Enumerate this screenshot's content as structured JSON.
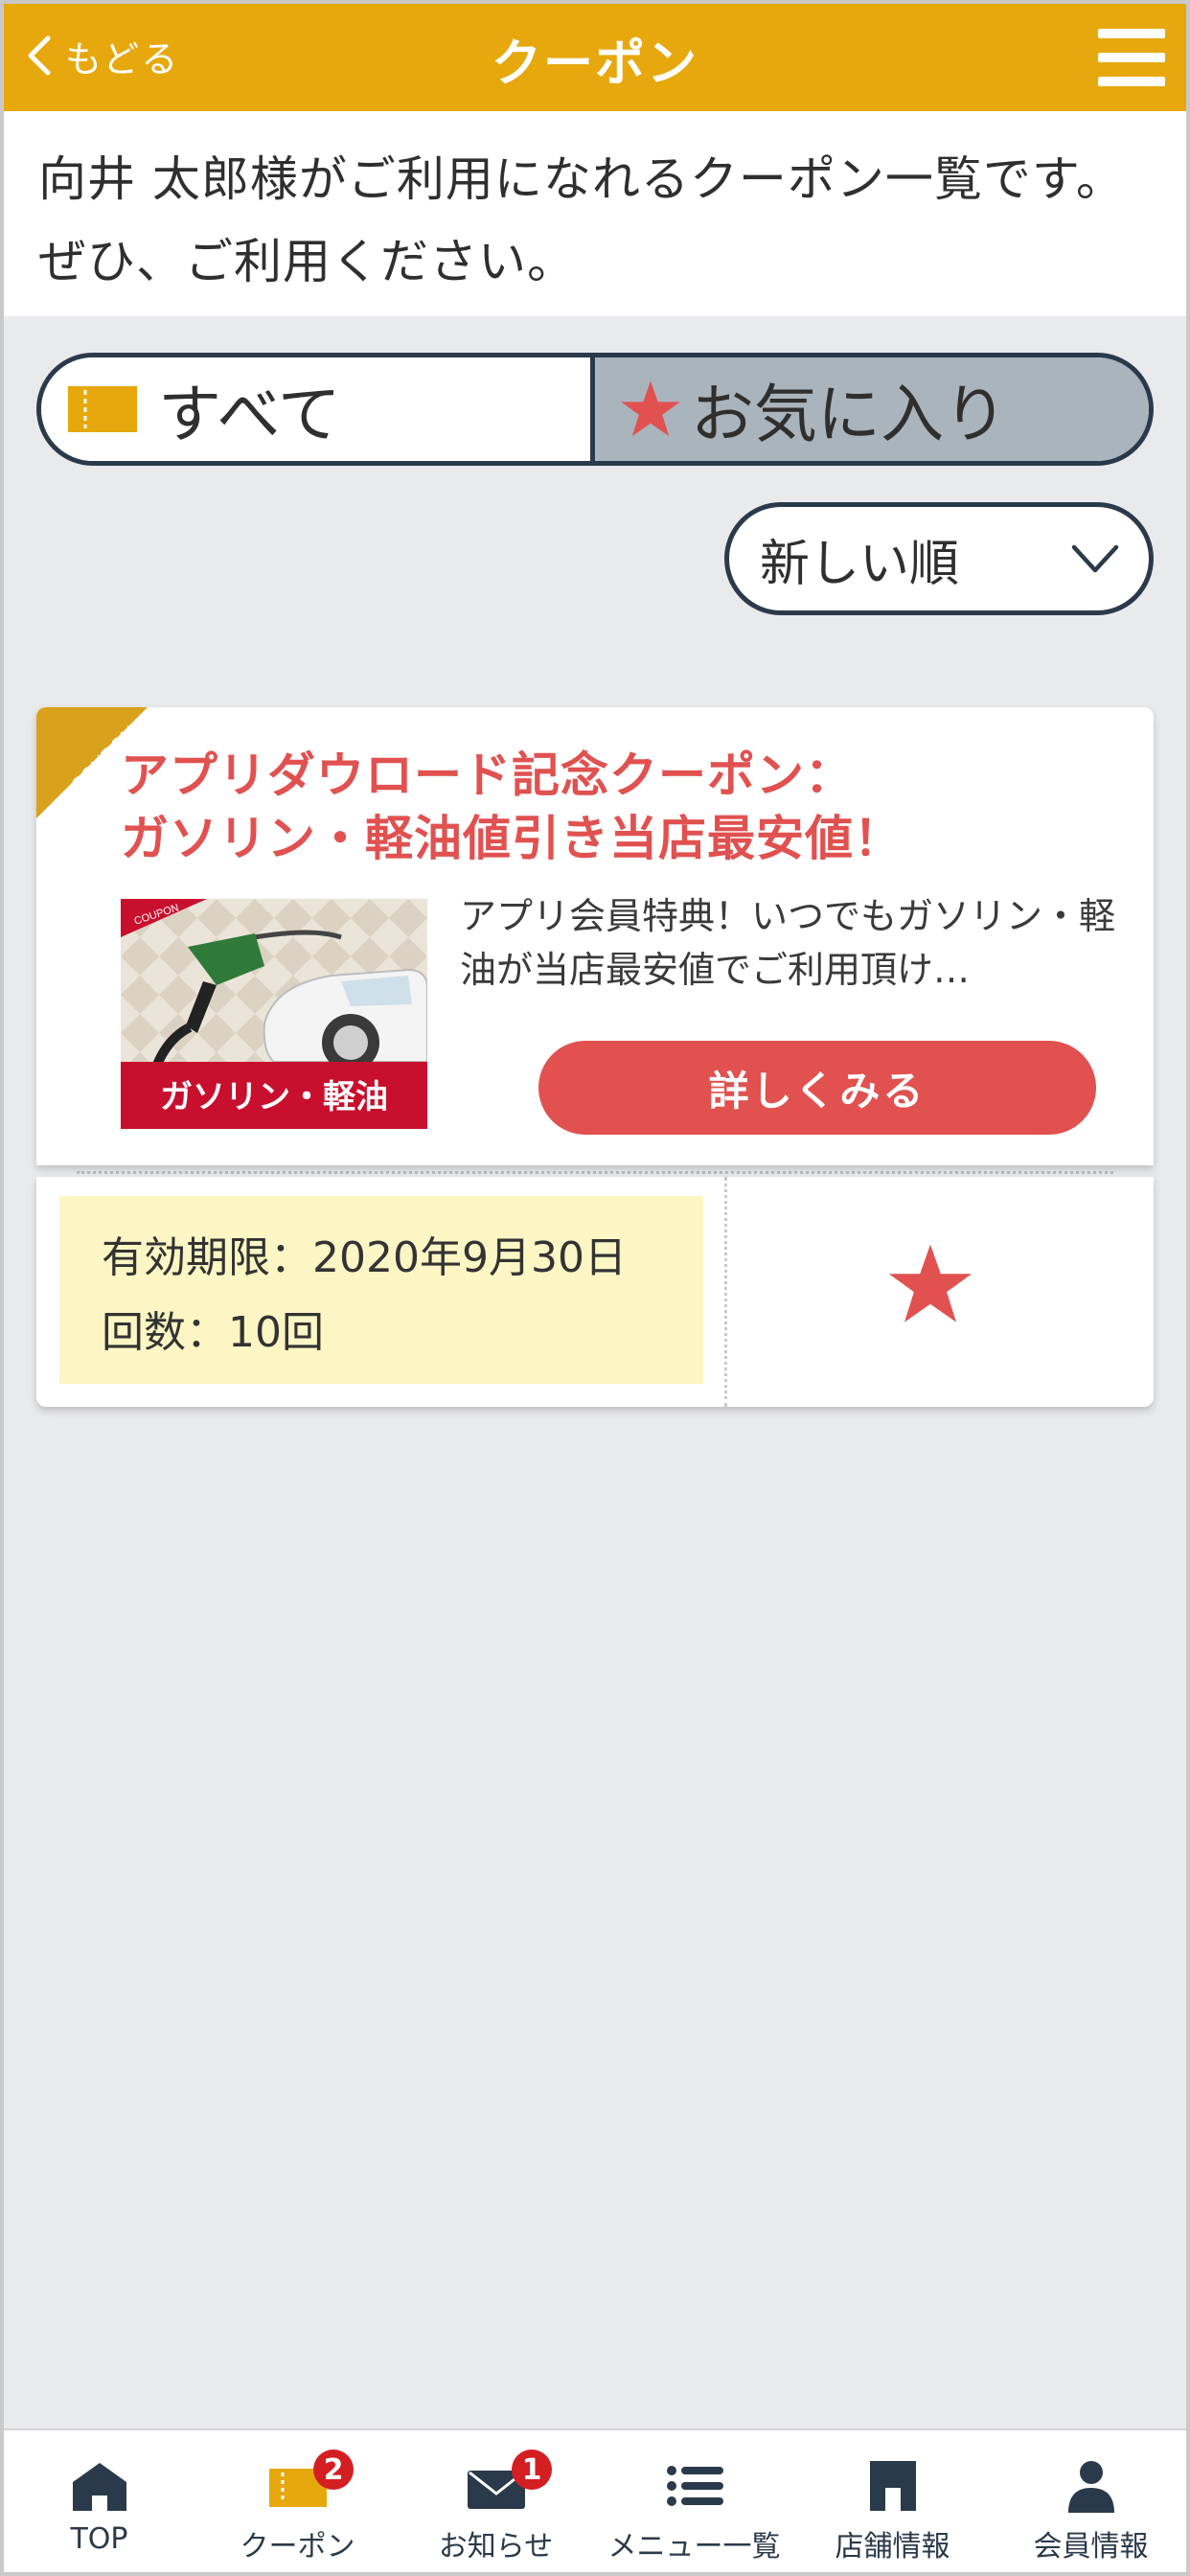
{
  "header": {
    "back_label": "もどる",
    "title": "クーポン"
  },
  "intro": {
    "text": "向井 太郎様がご利用になれるクーポン一覧です。ぜひ、ご利用ください。"
  },
  "filter": {
    "all_label": "すべて",
    "fav_label": "お気に入り",
    "active": "all"
  },
  "sort": {
    "selected": "新しい順"
  },
  "coupon": {
    "corner_label": "COUPON",
    "title_line1": "アプリダウロード記念クーポン：",
    "title_line2": "ガソリン・軽油値引き当店最安値！",
    "thumb_banner": "ガソリン・軽油",
    "thumb_tag": "COUPON",
    "description": "アプリ会員特典！いつでもガソリン・軽油が当店最安値でご利用頂け…",
    "detail_button": "詳しくみる",
    "validity": "有効期限：2020年9月30日",
    "count": "回数：10回"
  },
  "bottom_nav": [
    {
      "label": "TOP",
      "icon": "home-icon"
    },
    {
      "label": "クーポン",
      "icon": "ticket-icon",
      "badge": "2"
    },
    {
      "label": "お知らせ",
      "icon": "mail-icon",
      "badge": "1"
    },
    {
      "label": "メニュー一覧",
      "icon": "list-icon"
    },
    {
      "label": "店舗情報",
      "icon": "store-icon"
    },
    {
      "label": "会員情報",
      "icon": "person-icon"
    }
  ],
  "colors": {
    "header": "#e6a80d",
    "accent_red": "#e05150",
    "navy": "#2b3a4a",
    "validity_bg": "#fcf6c4",
    "fav_bg": "#aab4bd"
  }
}
